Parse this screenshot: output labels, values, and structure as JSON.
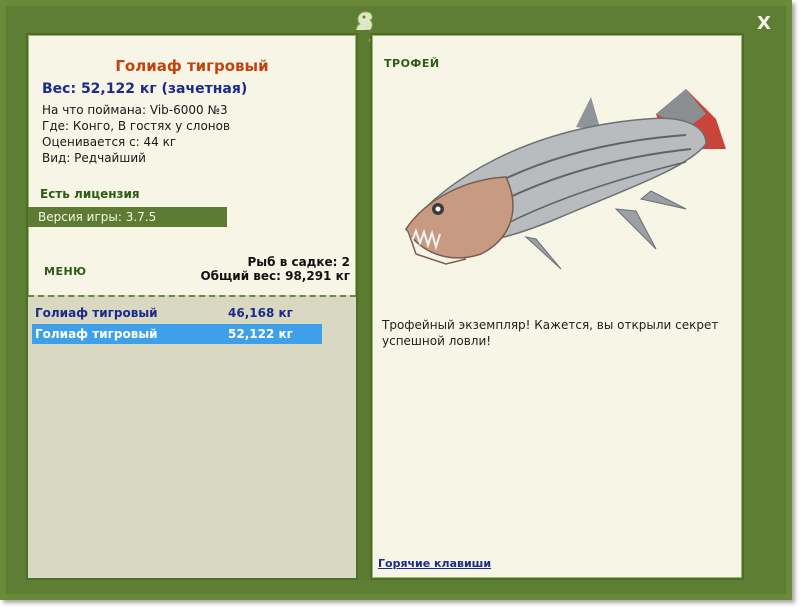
{
  "fish": {
    "title": "Голиаф тигровый",
    "weight": "Вес: 52,122 кг (зачетная)",
    "caught_with": "На что поймана: Vib-6000 №3",
    "location": "Где: Конго, В гостях у слонов",
    "value": "Оценивается с: 44 кг",
    "rarity": "Вид: Редчайший"
  },
  "left": {
    "license": "Есть лицензия",
    "version": "Версия игры: 3.7.5",
    "menu": "МЕНЮ",
    "fish_count": "Рыб в садке: 2",
    "total_weight": "Общий вес: 98,291 кг"
  },
  "list": [
    {
      "name": "Голиаф тигровый",
      "weight": "46,168 кг"
    },
    {
      "name": "Голиаф тигровый",
      "weight": "52,122 кг"
    }
  ],
  "right": {
    "section_title": "ТРОФЕЙ",
    "description": "Трофейный экземпляр! Кажется, вы открыли секрет успешной ловли!",
    "hotkeys": "Горячие клавиши"
  },
  "window": {
    "close_label": "X"
  },
  "icons": {
    "logo": "lizard-logo-icon",
    "fish": "tigerfish-image"
  }
}
